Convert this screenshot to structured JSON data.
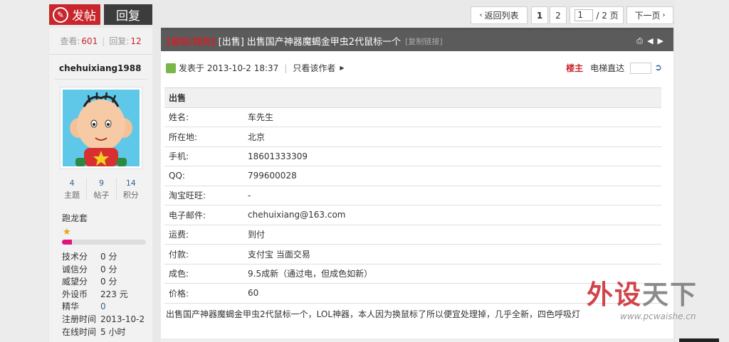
{
  "toolbar": {
    "post_label": "发帖",
    "reply_label": "回复",
    "back_label": "返回列表",
    "page1": "1",
    "page2": "2",
    "page_input": "1",
    "page_total": "/ 2 页",
    "next_label": "下一页"
  },
  "sidebar": {
    "view_label": "查看:",
    "view_count": "601",
    "reply_label": "回复:",
    "reply_count": "12",
    "username": "chehuixiang1988",
    "counts": [
      {
        "num": "4",
        "label": "主题"
      },
      {
        "num": "9",
        "label": "帖子"
      },
      {
        "num": "14",
        "label": "积分"
      }
    ],
    "group": "跑龙套",
    "progress_fraction": 0.12,
    "profile": [
      {
        "key": "技术分",
        "value": "0 分"
      },
      {
        "key": "诚信分",
        "value": "0 分"
      },
      {
        "key": "威望分",
        "value": "0 分"
      },
      {
        "key": "外设币",
        "value": "223 元"
      },
      {
        "key": "精华",
        "value": "0"
      },
      {
        "key": "注册时间",
        "value": "2013-10-2"
      },
      {
        "key": "在线时间",
        "value": "5 小时"
      }
    ]
  },
  "post": {
    "category": "[鼠标/线夹]",
    "type": "[出售]",
    "title": "出售国产神器魔蝎金甲虫2代鼠标一个",
    "copy_link": "[复制链接]",
    "posted": "发表于 2013-10-2 18:37",
    "author_only": "只看该作者",
    "host_label": "楼主",
    "jump_label": "电梯直达",
    "table_header": "出售",
    "table": [
      {
        "key": "姓名:",
        "value": "车先生"
      },
      {
        "key": "所在地:",
        "value": "北京"
      },
      {
        "key": "手机:",
        "value": "18601333309"
      },
      {
        "key": "QQ:",
        "value": "799600028"
      },
      {
        "key": "淘宝旺旺:",
        "value": "-"
      },
      {
        "key": "电子邮件:",
        "value": "chehuixiang@163.com"
      },
      {
        "key": "运费:",
        "value": "到付"
      },
      {
        "key": "付款:",
        "value": "支付宝 当面交易"
      },
      {
        "key": "成色:",
        "value": "9.5成新（通过电，但成色如新）"
      },
      {
        "key": "价格:",
        "value": "60"
      }
    ],
    "description": "出售国产神器魔蝎金甲虫2代鼠标一个，LOL神器，本人因为换鼠标了所以便宜处理掉，几乎全新，四色呼吸灯"
  },
  "watermark": {
    "text_red1": "外",
    "text_red2": "设",
    "text_grey": "天下",
    "url": "www.pcwaishe.cn"
  },
  "colors": {
    "accent_red": "#c8252c",
    "dark_button": "#3c3c3c",
    "link_blue": "#336699",
    "progress_pink": "#e3127e"
  },
  "icons": [
    "edit-icon",
    "print-icon",
    "arrow-left-icon",
    "arrow-right-icon",
    "user-icon",
    "triangle-right-icon",
    "go-icon",
    "star-icon"
  ]
}
